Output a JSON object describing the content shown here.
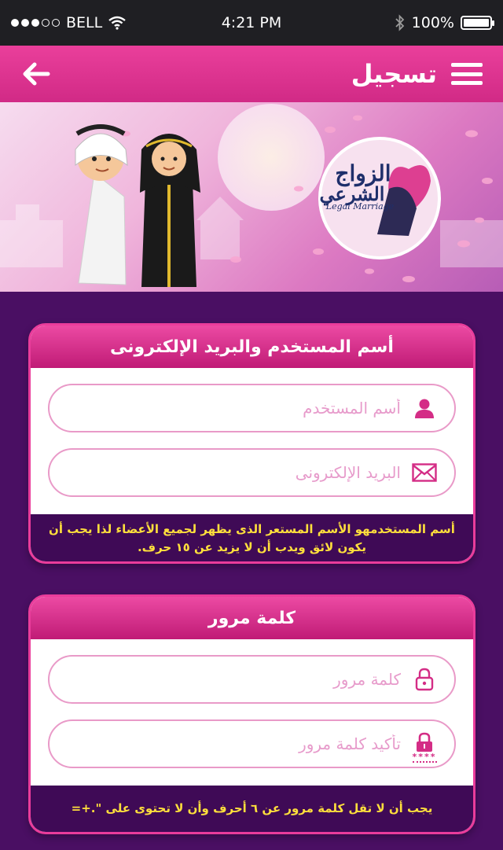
{
  "status_bar": {
    "carrier": "BELL",
    "time": "4:21 PM",
    "battery": "100%",
    "battery_level": 1.0
  },
  "header": {
    "title": "تسجيل"
  },
  "banner": {
    "logo_arabic_line1": "الزواج",
    "logo_arabic_line2": "الشرعي",
    "logo_english": "Legal Marriage"
  },
  "section_username": {
    "title": "أسم المستخدم  والبريد الإلكترونى",
    "username_placeholder": "أسم المستخدم",
    "email_placeholder": "البريد الإلكترونى",
    "note": "أسم المستخدمهو الأسم المستعر الذى يظهر لجميع الأعضاء لذا يجب أن يكون لائق ويدب أن لا يزيد عن ١٥ حرف."
  },
  "section_password": {
    "title": "كلمة مرور",
    "password_placeholder": "كلمة مرور",
    "confirm_placeholder": "تأكيد كلمة مرور",
    "confirm_icon_mask": "****",
    "note": "يجب أن لا تقل كلمة مرور عن ٦ أحرف وأن لا تحتوى على \".+="
  },
  "colors": {
    "header": "#d12a86",
    "background": "#4a0f63",
    "accent": "#ea3c9b",
    "note_text": "#ffdf3c"
  }
}
